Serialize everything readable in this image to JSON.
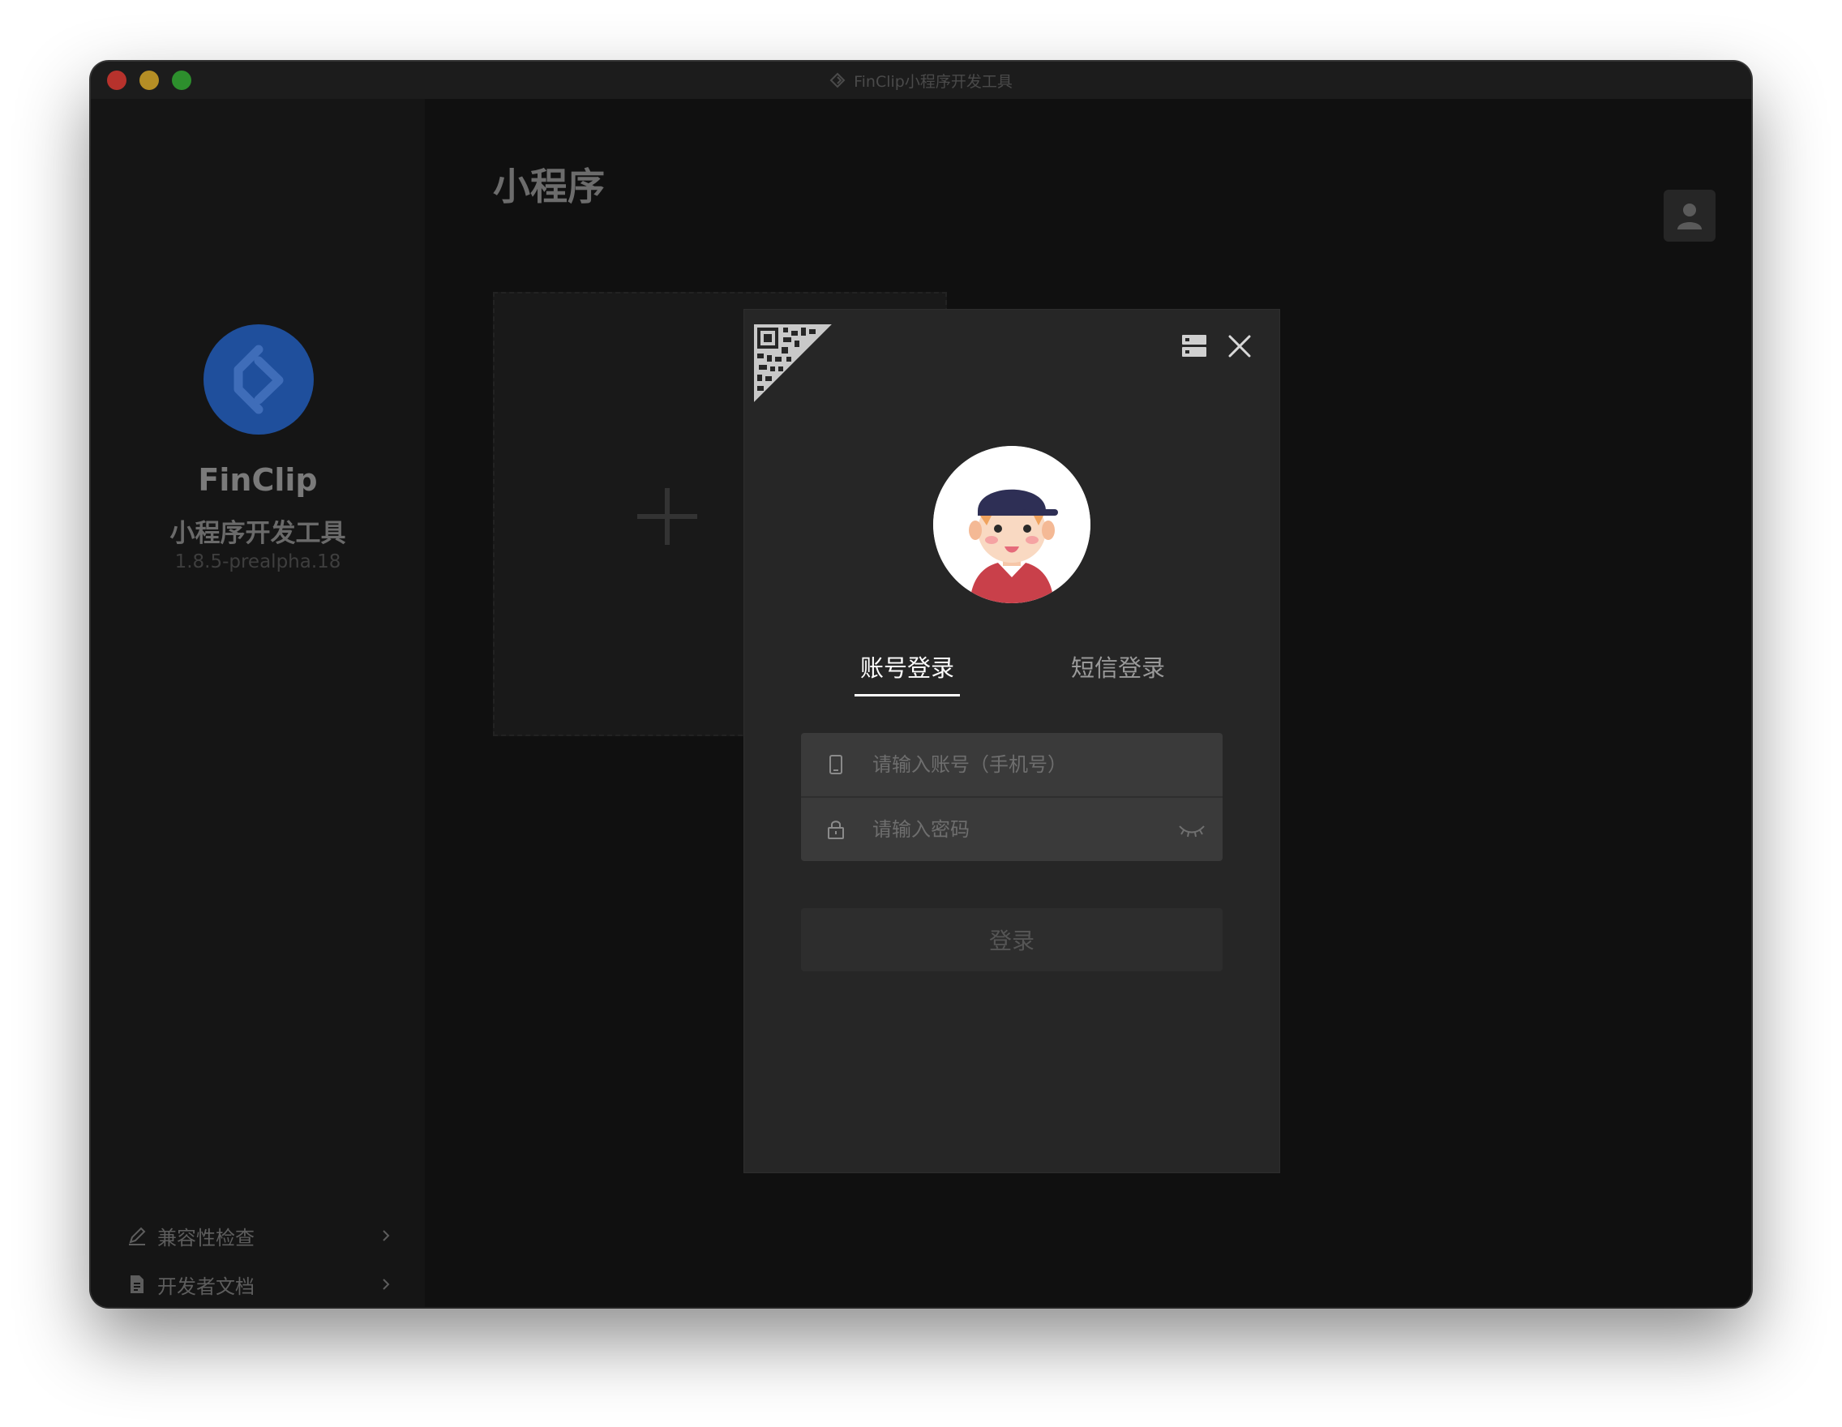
{
  "window": {
    "title": "FinClip小程序开发工具"
  },
  "sidebar": {
    "brand_name": "FinClip",
    "brand_subtitle": "小程序开发工具",
    "version": "1.8.5-prealpha.18",
    "links": [
      {
        "label": "兼容性检查",
        "icon": "pen-icon"
      },
      {
        "label": "开发者文档",
        "icon": "document-icon"
      }
    ]
  },
  "main": {
    "page_title": "小程序"
  },
  "login_modal": {
    "tabs": [
      {
        "label": "账号登录",
        "active": true
      },
      {
        "label": "短信登录",
        "active": false
      }
    ],
    "account_placeholder": "请输入账号（手机号）",
    "password_placeholder": "请输入密码",
    "login_button": "登录"
  },
  "colors": {
    "brand_blue": "#1f4f9c",
    "modal_bg": "#262626",
    "input_bg": "#3a3a3a"
  }
}
